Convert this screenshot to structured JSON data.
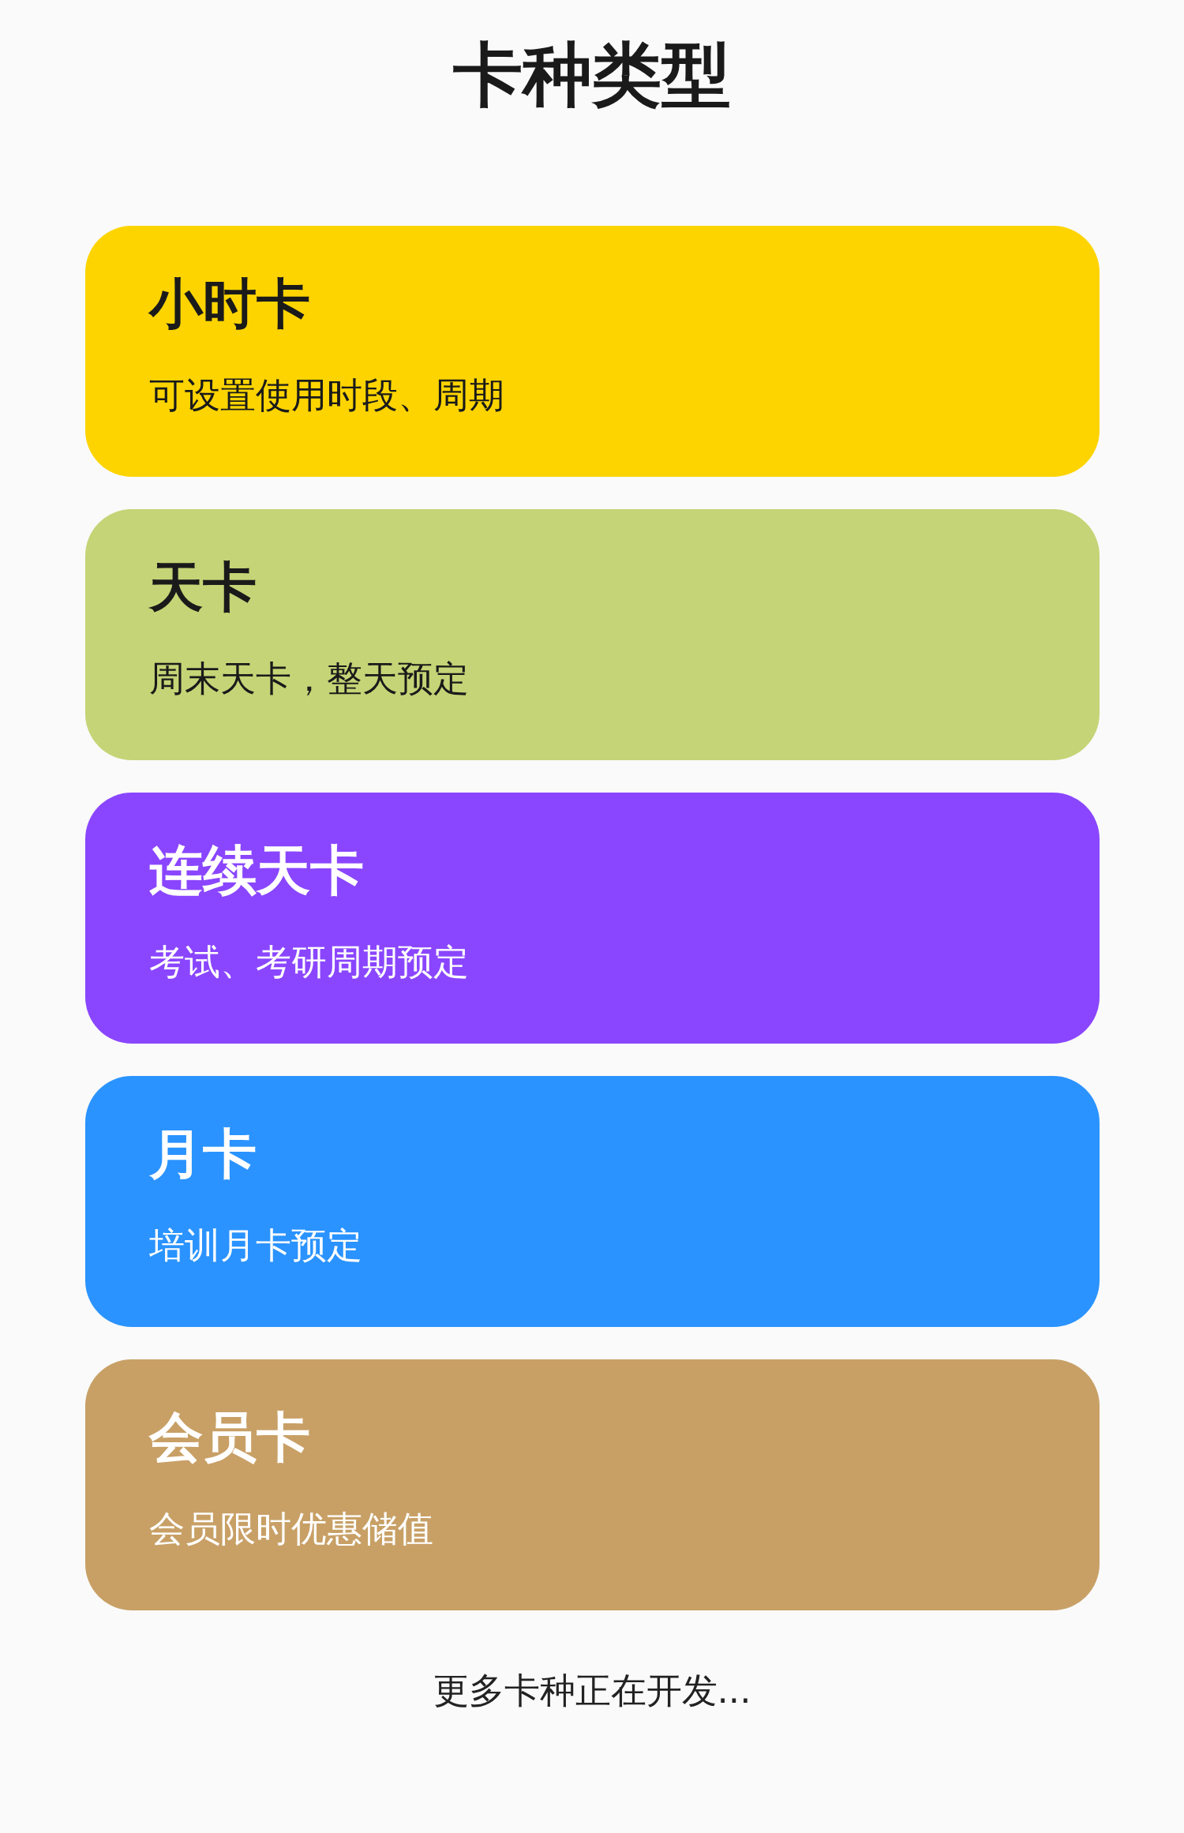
{
  "title": "卡种类型",
  "cards": [
    {
      "name": "小时卡",
      "description": "可设置使用时段、周期",
      "color": "#fdd400"
    },
    {
      "name": "天卡",
      "description": "周末天卡，整天预定",
      "color": "#c5d476"
    },
    {
      "name": "连续天卡",
      "description": "考试、考研周期预定",
      "color": "#8a46ff"
    },
    {
      "name": "月卡",
      "description": "培训月卡预定",
      "color": "#2a93ff"
    },
    {
      "name": "会员卡",
      "description": "会员限时优惠储值",
      "color": "#c8a066"
    }
  ],
  "footer": "更多卡种正在开发..."
}
